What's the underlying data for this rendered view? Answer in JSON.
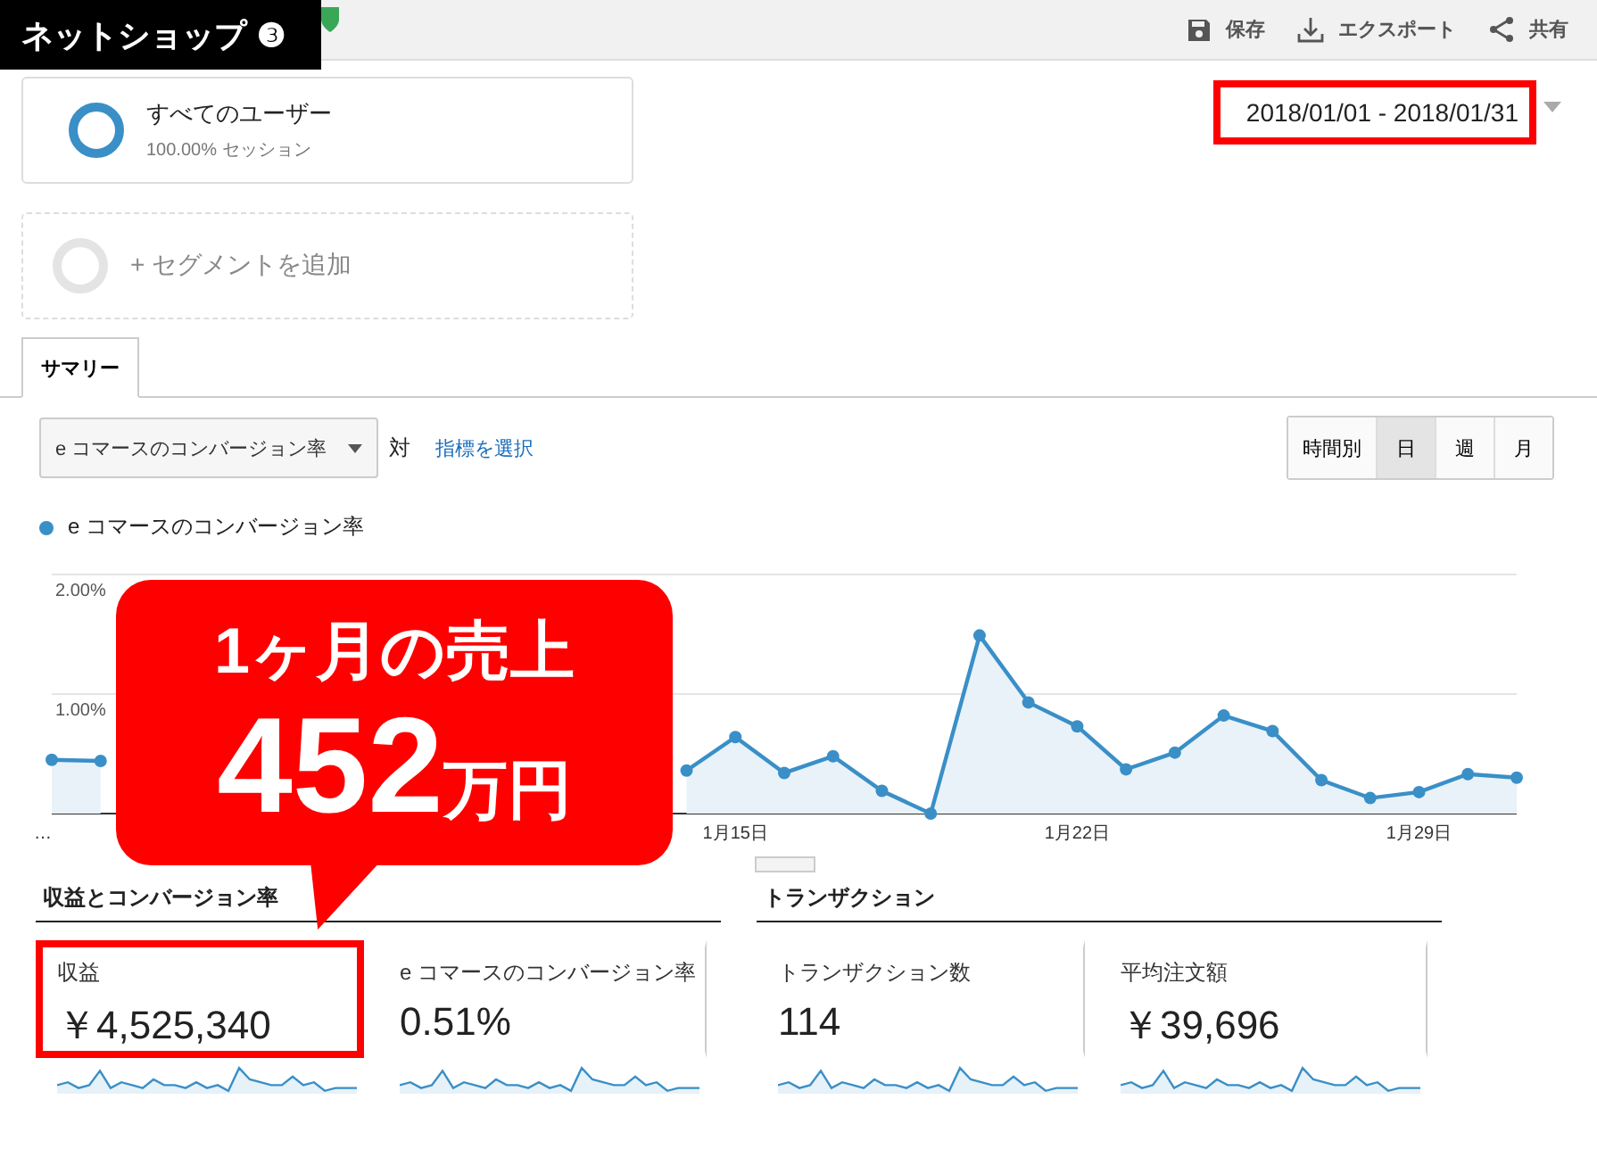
{
  "badge": {
    "title": "ネットショップ",
    "number": "❸"
  },
  "toolbar": [
    {
      "label": "保存",
      "kind": "save"
    },
    {
      "label": "エクスポート",
      "kind": "export"
    },
    {
      "label": "共有",
      "kind": "share"
    }
  ],
  "segments": [
    {
      "kind": "active",
      "name": "すべてのユーザー",
      "detail": "100.00% セッション"
    },
    {
      "kind": "add",
      "name": "+ セグメントを追加"
    }
  ],
  "date_range": {
    "value": "2018/01/01 - 2018/01/31",
    "highlighted": true
  },
  "tabs": [
    {
      "label": "サマリー",
      "selected": true
    }
  ],
  "metric_select": {
    "value": "e コマースのコンバージョン率",
    "versus": "対",
    "link": "指標を選択"
  },
  "granularity": [
    {
      "label": "時間別",
      "selected": false
    },
    {
      "label": "日",
      "selected": true
    },
    {
      "label": "週",
      "selected": false
    },
    {
      "label": "月",
      "selected": false
    }
  ],
  "chart": {
    "chart_data": {
      "type": "area",
      "x": [
        "…",
        null,
        null,
        null,
        null,
        null,
        null,
        null,
        null,
        null,
        null,
        null,
        null,
        null,
        "1月15日",
        null,
        null,
        null,
        null,
        null,
        null,
        "1月22日",
        null,
        null,
        null,
        null,
        null,
        null,
        "1月29日",
        null,
        null
      ],
      "yticks": [
        {
          "value": 1,
          "label": "1.00%"
        },
        {
          "value": 2,
          "label": "2.00%"
        }
      ],
      "ylim": [
        0,
        2
      ],
      "series": [
        {
          "name": "e コマースのコンバージョン率",
          "color": "#3a8fc7",
          "values": [
            0.45,
            0.44,
            null,
            null,
            null,
            null,
            null,
            null,
            null,
            null,
            null,
            null,
            null,
            0.36,
            0.64,
            0.34,
            0.48,
            0.19,
            0.0,
            1.49,
            0.93,
            0.73,
            0.37,
            0.51,
            0.82,
            0.69,
            0.28,
            0.13,
            0.18,
            0.33,
            0.3
          ]
        }
      ]
    }
  },
  "callout": {
    "line1": "1ヶ月の売上",
    "amount": "452",
    "unit": "万円"
  },
  "groups": [
    {
      "title": "収益とコンバージョン率",
      "metrics": [
        {
          "label": "収益",
          "value": "￥4,525,340",
          "highlighted": true
        },
        {
          "label": "e コマースのコンバージョン率",
          "value": "0.51%",
          "highlighted": false
        }
      ]
    },
    {
      "title": "トランザクション",
      "metrics": [
        {
          "label": "トランザクション数",
          "value": "114",
          "highlighted": false
        },
        {
          "label": "平均注文額",
          "value": "￥39,696",
          "highlighted": false
        }
      ]
    }
  ]
}
